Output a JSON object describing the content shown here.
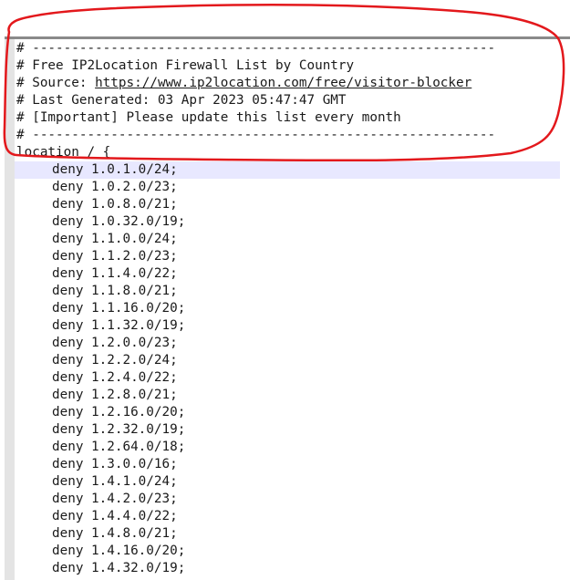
{
  "header_comments": [
    "# -----------------------------------------------------------",
    "# Free IP2Location Firewall List by Country",
    "# Source: ",
    "# Last Generated: 03 Apr 2023 05:47:47 GMT",
    "# [Important] Please update this list every month",
    "# -----------------------------------------------------------"
  ],
  "source_url": "https://www.ip2location.com/free/visitor-blocker",
  "location_line": "location / {",
  "deny_rules": [
    "deny 1.0.1.0/24;",
    "deny 1.0.2.0/23;",
    "deny 1.0.8.0/21;",
    "deny 1.0.32.0/19;",
    "deny 1.1.0.0/24;",
    "deny 1.1.2.0/23;",
    "deny 1.1.4.0/22;",
    "deny 1.1.8.0/21;",
    "deny 1.1.16.0/20;",
    "deny 1.1.32.0/19;",
    "deny 1.2.0.0/23;",
    "deny 1.2.2.0/24;",
    "deny 1.2.4.0/22;",
    "deny 1.2.8.0/21;",
    "deny 1.2.16.0/20;",
    "deny 1.2.32.0/19;",
    "deny 1.2.64.0/18;",
    "deny 1.3.0.0/16;",
    "deny 1.4.1.0/24;",
    "deny 1.4.2.0/23;",
    "deny 1.4.4.0/22;",
    "deny 1.4.8.0/21;",
    "deny 1.4.16.0/20;",
    "deny 1.4.32.0/19;"
  ],
  "colors": {
    "text": "#1a1a1a",
    "gutter": "#e4e4e4",
    "highlight": "#e8e8ff",
    "annotation": "#e3181c",
    "border": "#8a8a8a"
  }
}
